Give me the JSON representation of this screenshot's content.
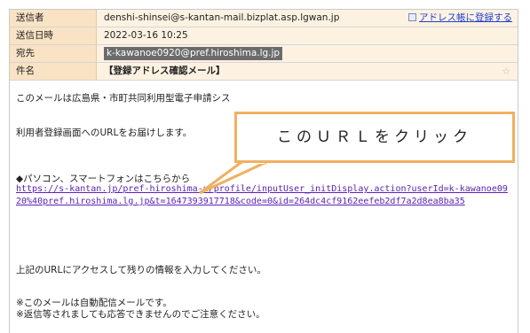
{
  "header": {
    "sender_label": "送信者",
    "sender_value": "denshi-shinsei@s-kantan-mail.bizplat.asp.lgwan.jp",
    "add_to_address_book": "アドレス帳に登録する",
    "datetime_label": "送信日時",
    "datetime_value": "2022-03-16 10:25",
    "to_label": "宛先",
    "to_value": "k-kawanoe0920@pref.hiroshima.lg.jp",
    "subject_label": "件名",
    "subject_value": "【登録アドレス確認メール】"
  },
  "body": {
    "line1": "このメールは広島県・市町共同利用型電子申請シス",
    "line2": "利用者登録画面へのURLをお届けします。",
    "line3": "◆パソコン、スマートフォンはこちらから",
    "url": "https://s-kantan.jp/pref-hiroshima-u/profile/inputUser_initDisplay.action?userId=k-kawanoe0920%40pref.hiroshima.lg.jp&t=1647393917718&code=0&id=264dc4cf9162eefeb2df7a2d8ea8ba35",
    "line4": "上記のURLにアクセスして残りの情報を入力してください。",
    "line5": "※このメールは自動配信メールです。",
    "line6": "※返信等されましても応答できませんのでご注意ください。"
  },
  "callout": {
    "text": "このＵＲＬをクリック"
  },
  "colors": {
    "header_label_bg": "#f9e3c4",
    "header_value_bg": "#fdf2e2",
    "callout_border": "#f0b060",
    "link": "#2040d0",
    "url": "#5b21b6"
  },
  "icons": {
    "address_book": "address-book-icon",
    "star": "star-icon"
  }
}
